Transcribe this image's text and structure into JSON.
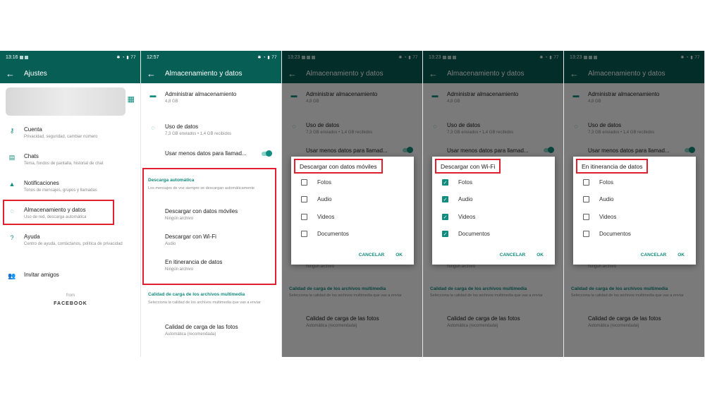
{
  "panel1": {
    "time": "13:16",
    "battery": "77",
    "title": "Ajustes",
    "items": [
      {
        "title": "Cuenta",
        "subtitle": "Privacidad, seguridad, cambiar número"
      },
      {
        "title": "Chats",
        "subtitle": "Tema, fondos de pantalla, historial de chat"
      },
      {
        "title": "Notificaciones",
        "subtitle": "Tonos de mensajes, grupos y llamadas"
      },
      {
        "title": "Almacenamiento y datos",
        "subtitle": "Uso de red, descarga automática"
      },
      {
        "title": "Ayuda",
        "subtitle": "Centro de ayuda, contáctanos, política de privacidad"
      },
      {
        "title": "Invitar amigos",
        "subtitle": ""
      }
    ],
    "from": "from",
    "brand": "FACEBOOK"
  },
  "panel2": {
    "time": "12:57",
    "battery": "77",
    "title": "Almacenamiento y datos",
    "manage_storage": {
      "title": "Administrar almacenamiento",
      "subtitle": "4,8 GB"
    },
    "data_usage": {
      "title": "Uso de datos",
      "subtitle": "7,3 GB enviados • 1,4 GB recibidos"
    },
    "less_data": "Usar menos datos para llamad...",
    "auto_download_header": "Descarga automática",
    "auto_download_desc": "Los mensajes de voz siempre se descargan automáticamente",
    "auto_items": [
      {
        "title": "Descargar con datos móviles",
        "subtitle": "Ningún archivo"
      },
      {
        "title": "Descargar con Wi-Fi",
        "subtitle": "Audio"
      },
      {
        "title": "En itinerancia de datos",
        "subtitle": "Ningún archivo"
      }
    ],
    "media_header": "Calidad de carga de los archivos multimedia",
    "media_desc": "Selecciona la calidad de los archivos multimedia que vas a enviar",
    "photo_quality": {
      "title": "Calidad de carga de las fotos",
      "subtitle": "Automática (recomendada)"
    }
  },
  "dialog_common": {
    "options": [
      "Fotos",
      "Audio",
      "Videos",
      "Documentos"
    ],
    "cancel": "CANCELAR",
    "ok": "OK"
  },
  "dialogs": [
    {
      "time": "13:23",
      "title": "Descargar con datos móviles",
      "checked": [
        false,
        false,
        false,
        false
      ]
    },
    {
      "time": "13:23",
      "title": "Descargar con Wi-Fi",
      "checked": [
        true,
        true,
        true,
        true
      ]
    },
    {
      "time": "13:23",
      "title": "En itinerancia de datos",
      "checked": [
        false,
        false,
        false,
        false
      ]
    }
  ],
  "colors": {
    "primary": "#075e54",
    "accent": "#128c7e",
    "highlight": "#e02030"
  }
}
